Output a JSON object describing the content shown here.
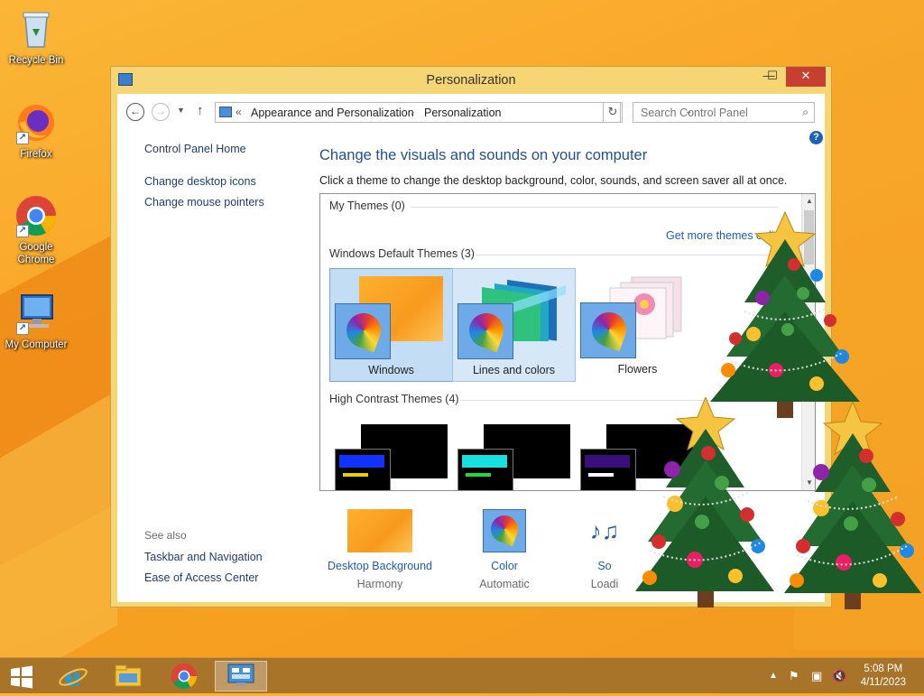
{
  "colors": {
    "wallpaper": "#f9a323",
    "window_frame": "#f6d574",
    "close_button": "#c7402f",
    "link": "#1e5cb3",
    "heading": "#1e4f96",
    "taskbar": "#a8742a",
    "selected_tile": "#c3ddf4"
  },
  "desktop": {
    "icons": [
      {
        "label": "Recycle Bin",
        "icon": "recycle-bin-icon"
      },
      {
        "label": "Firefox",
        "icon": "firefox-icon"
      },
      {
        "label": "Google Chrome",
        "icon": "chrome-icon"
      },
      {
        "label": "My Computer",
        "icon": "computer-icon"
      }
    ]
  },
  "window": {
    "title": "Personalization",
    "controls": {
      "minimize": "—",
      "maximize": "☐",
      "close": "✕"
    }
  },
  "address_bar": {
    "prefix": "«",
    "crumbs": [
      "Appearance and Personalization",
      "Personalization"
    ],
    "separator": "›"
  },
  "search": {
    "placeholder": "Search Control Panel"
  },
  "left_pane": {
    "home": "Control Panel Home",
    "links": [
      "Change desktop icons",
      "Change mouse pointers"
    ],
    "see_also_title": "See also",
    "see_also": [
      "Taskbar and Navigation",
      "Ease of Access Center"
    ]
  },
  "main": {
    "heading": "Change the visuals and sounds on your computer",
    "subtext": "Click a theme to change the desktop background, color, sounds, and screen saver all at once.",
    "groups": {
      "my_themes": "My Themes (0)",
      "default_themes": "Windows Default Themes (3)",
      "high_contrast": "High Contrast Themes (4)"
    },
    "get_more": "Get more themes online",
    "themes": [
      {
        "name": "Windows",
        "selected": true
      },
      {
        "name": "Lines and colors",
        "selected": false
      },
      {
        "name": "Flowers",
        "selected": false
      }
    ]
  },
  "bottom": {
    "items": [
      {
        "link": "Desktop Background",
        "sub": "Harmony"
      },
      {
        "link": "Color",
        "sub": "Automatic"
      },
      {
        "link": "So",
        "sub": "Loadi"
      }
    ]
  },
  "taskbar": {
    "items": [
      "windows-start-icon",
      "internet-explorer-icon",
      "file-explorer-icon",
      "chrome-icon",
      "control-panel-icon"
    ],
    "active": "control-panel-icon",
    "tray": {
      "expand": "▲",
      "flag": "⚑",
      "network": "▣",
      "volume": "🔇"
    },
    "time": "5:08 PM",
    "date": "4/11/2023"
  }
}
